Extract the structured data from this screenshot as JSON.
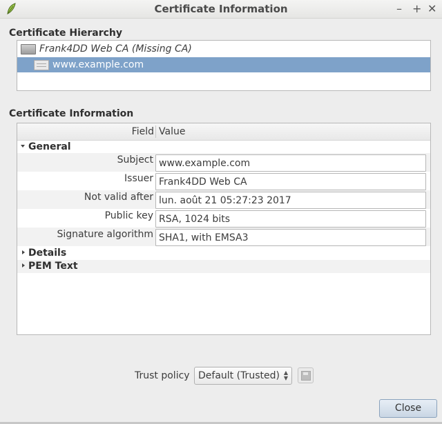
{
  "window": {
    "title": "Certificate Information",
    "minimize_glyph": "–",
    "maximize_glyph": "+",
    "close_glyph": "✕"
  },
  "hierarchy": {
    "heading": "Certificate Hierarchy",
    "items": [
      {
        "label": "Frank4DD Web CA (Missing CA)",
        "icon": "certificate-icon",
        "selected": false
      },
      {
        "label": "www.example.com",
        "icon": "certificate-icon",
        "selected": true
      }
    ]
  },
  "info": {
    "heading": "Certificate Information",
    "columns": {
      "field": "Field",
      "value": "Value"
    },
    "general": {
      "label": "General",
      "rows": [
        {
          "field": "Subject",
          "value": "www.example.com"
        },
        {
          "field": "Issuer",
          "value": "Frank4DD Web CA"
        },
        {
          "field": "Not valid after",
          "value": "lun. août 21 05:27:23 2017"
        },
        {
          "field": "Public key",
          "value": "RSA, 1024 bits"
        },
        {
          "field": "Signature algorithm",
          "value": "SHA1, with EMSA3"
        }
      ]
    },
    "details_label": "Details",
    "pem_label": "PEM Text"
  },
  "trust": {
    "label": "Trust policy",
    "selected": "Default (Trusted)"
  },
  "buttons": {
    "close_label": "Close"
  },
  "colors": {
    "selection": "#7ea2c9"
  }
}
